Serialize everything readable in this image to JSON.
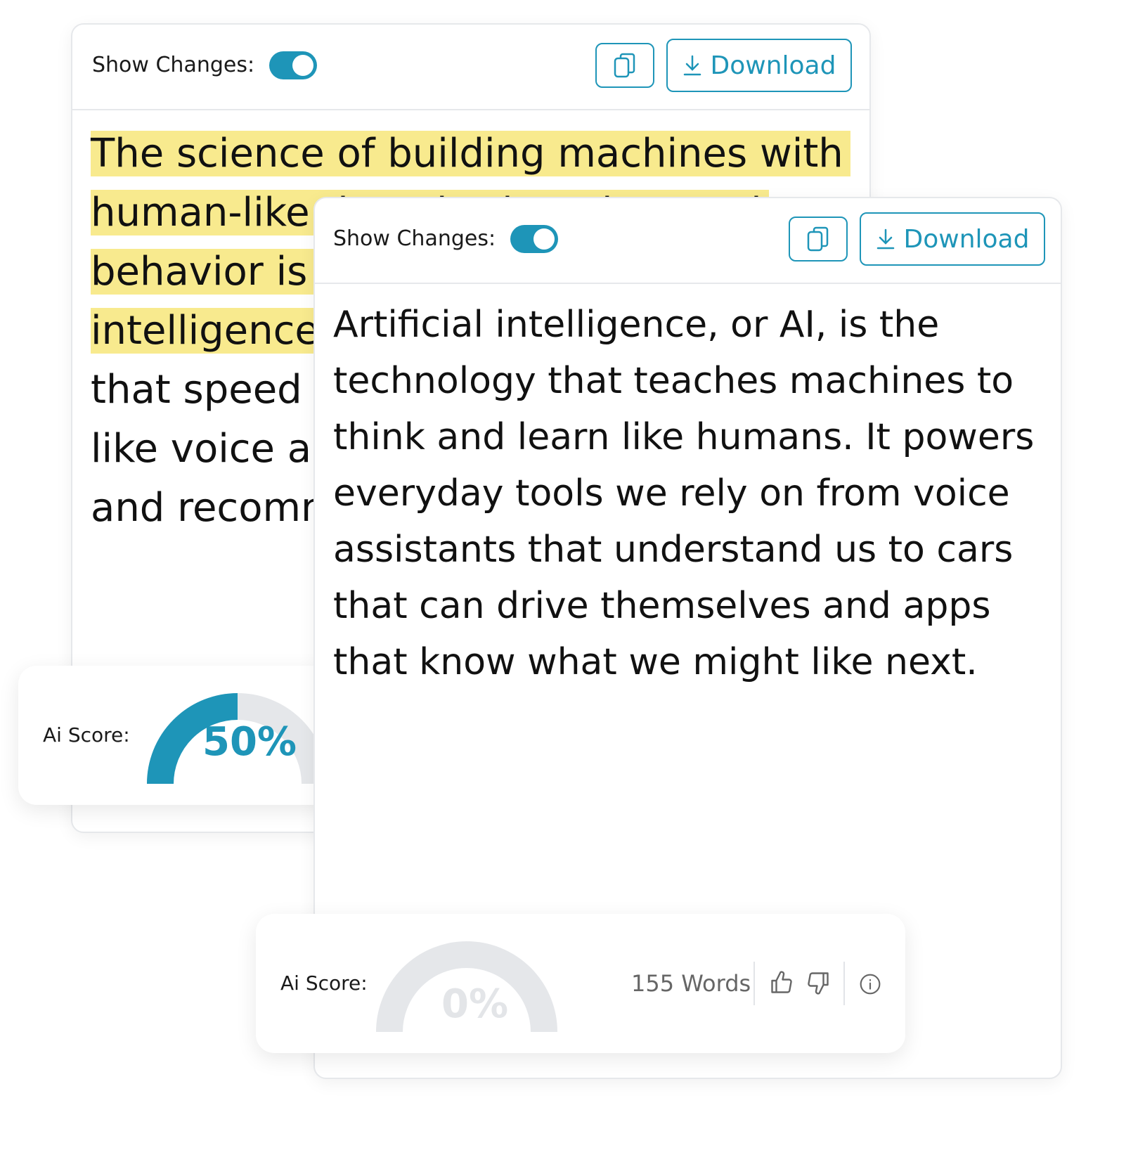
{
  "back_panel": {
    "show_changes_label": "Show Changes:",
    "download_label": "Download",
    "lines": [
      "The science of building machines with",
      "human-like thought, learning, and",
      "behavior is known as artificial",
      "intelligence, or AI. It powers tools",
      "that speed up everyday tasks,",
      "like voice assistants, self-driving cars,",
      "and recommendation apps."
    ],
    "score_label": "Ai Score:",
    "score_value": "50%",
    "score_fraction": 0.5
  },
  "front_panel": {
    "show_changes_label": "Show Changes:",
    "download_label": "Download",
    "lines": [
      "Artificial intelligence, or AI, is the",
      "technology that teaches machines to",
      "think and learn like humans. It powers",
      "everyday tools we rely on from voice",
      "assistants that understand us to cars",
      "that can drive themselves and apps",
      "that know what we might like next."
    ],
    "score_label": "Ai Score:",
    "score_value": "0%",
    "score_fraction": 0,
    "word_count": "155 Words"
  },
  "colors": {
    "accent": "#1e95b8",
    "highlight": "#f8ea8e",
    "gauge_track": "#e5e7ea"
  },
  "icons": [
    "copy-icon",
    "download-icon",
    "thumbs-up-icon",
    "thumbs-down-icon",
    "info-icon"
  ]
}
